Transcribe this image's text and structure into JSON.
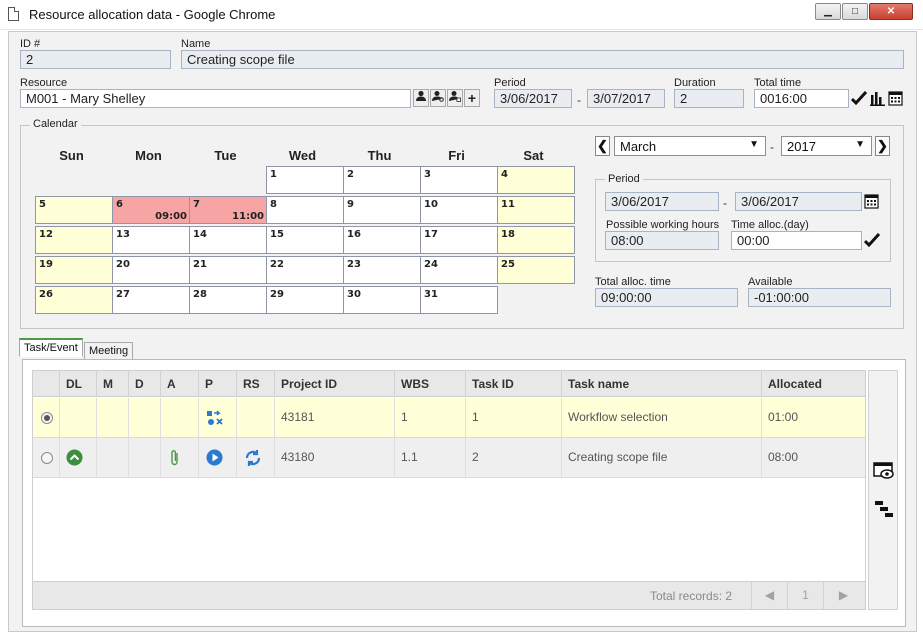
{
  "window": {
    "title": "Resource allocation data - Google Chrome",
    "min": "▁",
    "max": "□",
    "close": "✕"
  },
  "form": {
    "id_label": "ID #",
    "id_value": "2",
    "name_label": "Name",
    "name_value": "Creating scope file",
    "resource_label": "Resource",
    "resource_value": "M001 - Mary Shelley",
    "period_label": "Period",
    "period_start": "3/06/2017",
    "period_end": "3/07/2017",
    "duration_label": "Duration",
    "duration_value": "2",
    "total_time_label": "Total time",
    "total_time_value": "0016:00",
    "dash": "-"
  },
  "calendar": {
    "title": "Calendar",
    "days": [
      "Sun",
      "Mon",
      "Tue",
      "Wed",
      "Thu",
      "Fri",
      "Sat"
    ],
    "weeks": [
      [
        "",
        "",
        "",
        "1",
        "2",
        "3",
        "4"
      ],
      [
        "5",
        "6",
        "7",
        "8",
        "9",
        "10",
        "11"
      ],
      [
        "12",
        "13",
        "14",
        "15",
        "16",
        "17",
        "18"
      ],
      [
        "19",
        "20",
        "21",
        "22",
        "23",
        "24",
        "25"
      ],
      [
        "26",
        "27",
        "28",
        "29",
        "30",
        "31",
        ""
      ]
    ],
    "allocations": {
      "6": "09:00",
      "7": "11:00"
    },
    "month": "March",
    "year": "2017",
    "period_title": "Period",
    "period_start": "3/06/2017",
    "period_end": "3/06/2017",
    "possible_hours_label": "Possible working hours",
    "possible_hours_value": "08:00",
    "time_alloc_label": "Time alloc.(day)",
    "time_alloc_value": "00:00",
    "total_alloc_label": "Total alloc. time",
    "total_alloc_value": "09:00:00",
    "available_label": "Available",
    "available_value": "-01:00:00"
  },
  "tabs": [
    "Task/Event",
    "Meeting"
  ],
  "grid": {
    "headers": [
      "DL",
      "M",
      "D",
      "A",
      "P",
      "RS",
      "Project ID",
      "WBS",
      "Task ID",
      "Task name",
      "Allocated"
    ],
    "rows": [
      {
        "project_id": "43181",
        "wbs": "1",
        "task_id": "1",
        "task_name": "Workflow selection",
        "allocated": "01:00"
      },
      {
        "project_id": "43180",
        "wbs": "1.1",
        "task_id": "2",
        "task_name": "Creating scope file",
        "allocated": "08:00"
      }
    ],
    "total_records": "Total records: 2",
    "page": "1",
    "prev": "◀",
    "next": "▶"
  },
  "colors": {
    "weekend": "#ffffd8",
    "allocated": "#f6a4a4",
    "accent_green": "#4a9a4a",
    "accent_blue": "#2a7ad2"
  }
}
